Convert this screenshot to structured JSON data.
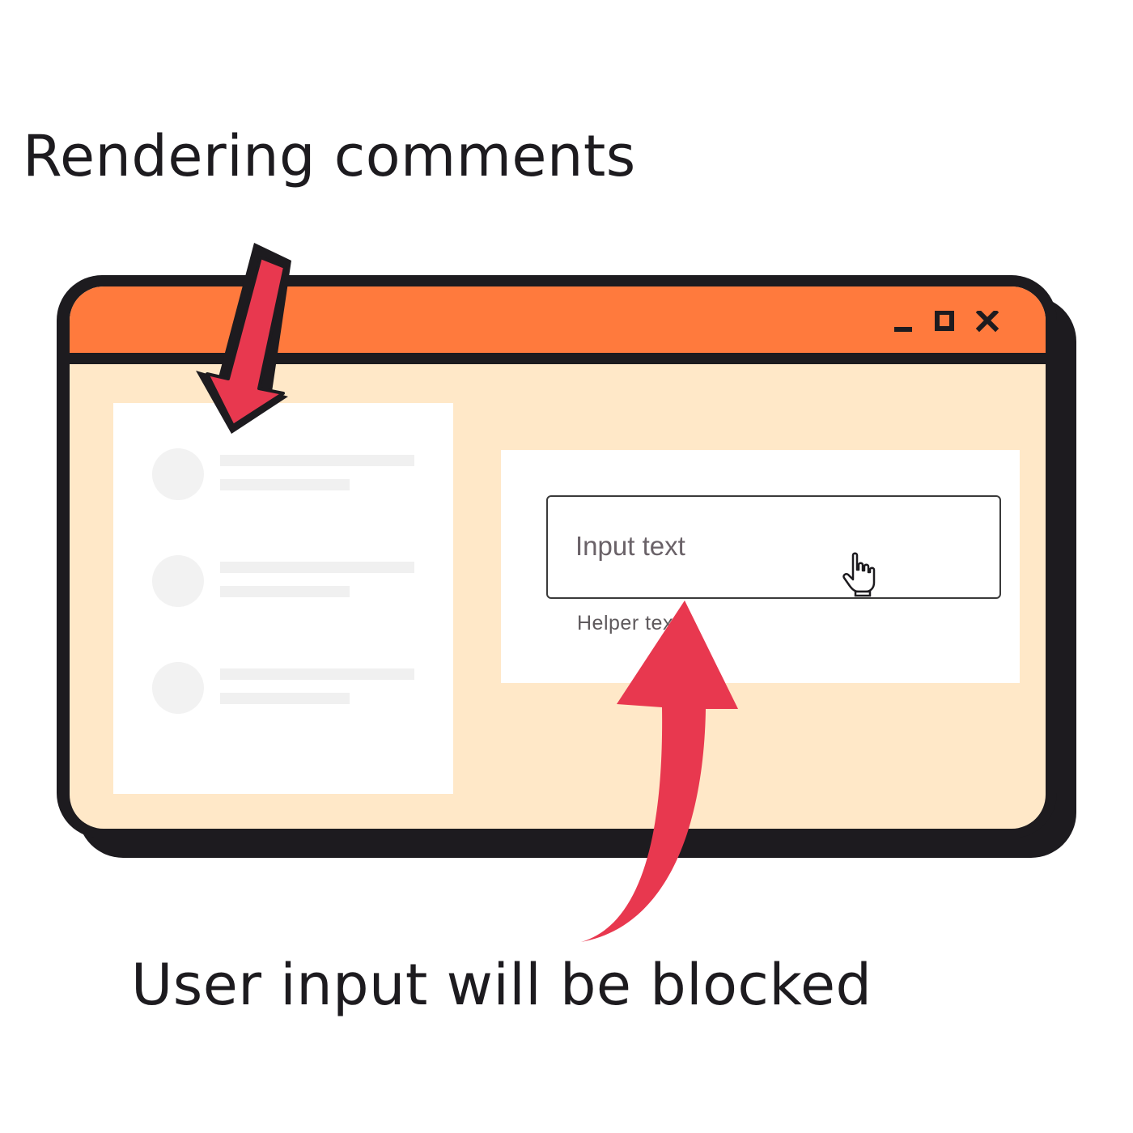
{
  "annotations": {
    "top_caption": "Rendering comments",
    "bottom_caption": "User input will be blocked"
  },
  "window": {
    "controls": [
      "minimize-icon",
      "maximize-icon",
      "close-icon"
    ]
  },
  "comments_panel": {
    "item_count": 3
  },
  "input_panel": {
    "placeholder": "Input text",
    "helper_text": "Helper text"
  },
  "colors": {
    "titlebar": "#ff7a3d",
    "window_body": "#ffe8c8",
    "outline": "#1d1b1f",
    "arrow": "#e8384f",
    "text": "#1d1b1f"
  }
}
